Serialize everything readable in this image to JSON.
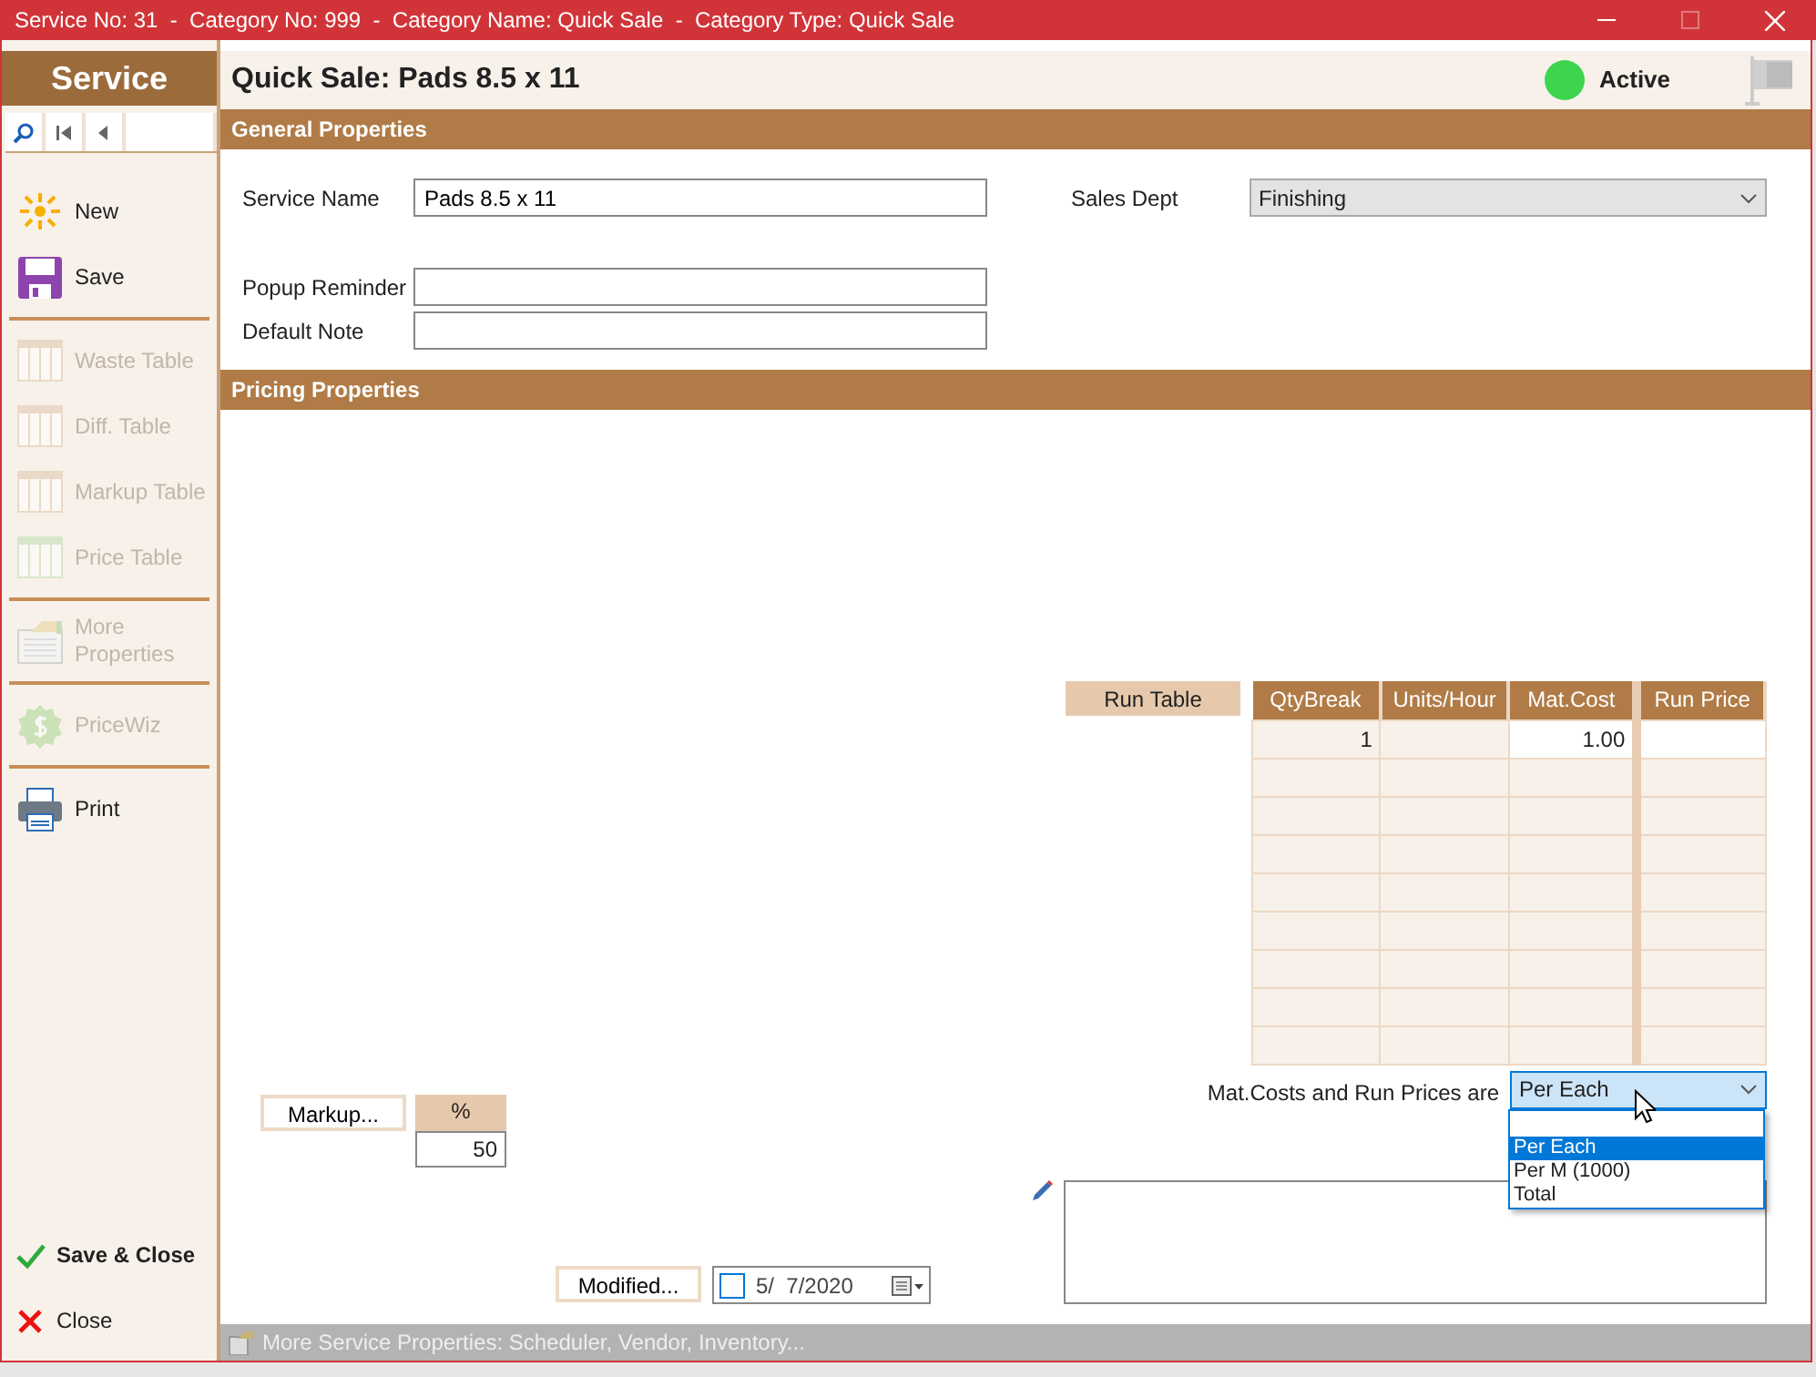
{
  "window": {
    "title": "Service No: 31  -  Category No: 999  -  Category Name: Quick Sale  -  Category Type: Quick Sale"
  },
  "sidebar": {
    "title": "Service",
    "groups": [
      [
        {
          "label": "New",
          "disabled": false
        },
        {
          "label": "Save",
          "disabled": false
        }
      ],
      [
        {
          "label": "Waste Table",
          "disabled": true
        },
        {
          "label": "Diff. Table",
          "disabled": true
        },
        {
          "label": "Markup Table",
          "disabled": true
        },
        {
          "label": "Price Table",
          "disabled": true
        }
      ],
      [
        {
          "label": "More Properties",
          "disabled": true
        }
      ],
      [
        {
          "label": "PriceWiz",
          "disabled": true
        }
      ],
      [
        {
          "label": "Print",
          "disabled": false
        }
      ]
    ],
    "footer": [
      {
        "label": "Save & Close",
        "bold": true
      },
      {
        "label": "Close",
        "bold": false
      }
    ]
  },
  "header": {
    "title": "Quick Sale: Pads 8.5 x 11",
    "status": {
      "label": "Active",
      "active": true
    }
  },
  "general": {
    "title": "General Properties",
    "service_name": {
      "label": "Service Name",
      "value": "Pads 8.5 x 11"
    },
    "sales_dept": {
      "label": "Sales Dept",
      "value": "Finishing"
    },
    "popup_reminder": {
      "label": "Popup Reminder"
    },
    "default_note": {
      "label": "Default Note"
    }
  },
  "pricing": {
    "title": "Pricing Properties",
    "run_table_label": "Run Table",
    "table": {
      "columns": [
        "QtyBreak",
        "Units/Hour",
        "Mat.Cost",
        "Run Price"
      ],
      "rows": [
        [
          "1",
          null,
          "1.00",
          null
        ]
      ]
    },
    "price_basis": {
      "label": "Mat.Costs and Run Prices are",
      "value": "Per Each",
      "expanded": true,
      "options": [
        {
          "label": "Per Each",
          "selected": true
        },
        {
          "label": "Per M (1000)",
          "selected": false
        },
        {
          "label": "Total",
          "selected": false
        }
      ]
    },
    "markup": {
      "button": "Markup...",
      "column": "%",
      "value": "50"
    },
    "modified": {
      "button": "Modified...",
      "checked": false,
      "date": "5/  7/2020"
    }
  },
  "status_bar": {
    "text": "More Service Properties: Scheduler, Vendor, Inventory..."
  }
}
